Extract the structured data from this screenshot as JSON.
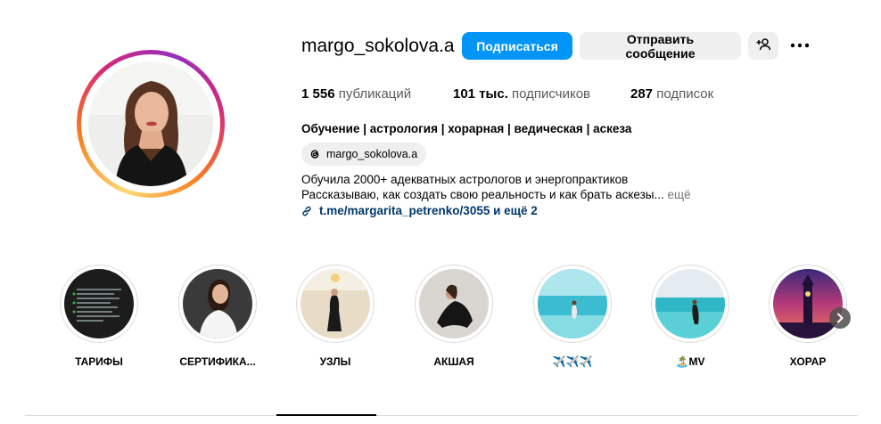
{
  "profile": {
    "username": "margo_sokolova.a",
    "follow_label": "Подписаться",
    "message_label": "Отправить сообщение",
    "stats": {
      "posts_count": "1 556",
      "posts_label": "публикаций",
      "followers_count": "101 тыс.",
      "followers_label": "подписчиков",
      "following_count": "287",
      "following_label": "подписок"
    },
    "bio_title": "Обучение | астрология | хорарная | ведическая | аскеза",
    "threads_handle": "margo_sokolova.a",
    "bio_line1": "Обучила 2000+ адекватных астрологов и энергопрактиков",
    "bio_line2": "Рассказываю, как создать свою реальность и как брать аскезы...",
    "more_label": "ещё",
    "link_text": "t.me/margarita_petrenko/3055 и ещё 2"
  },
  "highlights": [
    {
      "label": "ТАРИФЫ"
    },
    {
      "label": "СЕРТИФИКА..."
    },
    {
      "label": "УЗЛЫ"
    },
    {
      "label": "АКШАЯ"
    },
    {
      "label": "✈️✈️✈️"
    },
    {
      "label": "🏝️MV"
    },
    {
      "label": "ХОРАР"
    }
  ],
  "colors": {
    "accent": "#0095f6",
    "link": "#00376b",
    "secondary_button": "#efefef"
  }
}
